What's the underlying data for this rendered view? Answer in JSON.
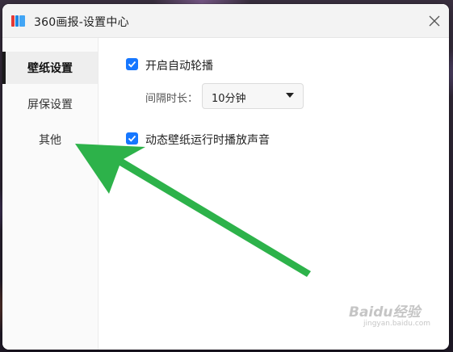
{
  "window": {
    "title": "360画报-设置中心"
  },
  "sidebar": {
    "items": [
      {
        "label": "壁纸设置",
        "active": true
      },
      {
        "label": "屏保设置",
        "active": false
      },
      {
        "label": "其他",
        "active": false
      }
    ]
  },
  "wallpaper_settings": {
    "auto_rotate": {
      "label": "开启自动轮播",
      "checked": true
    },
    "interval": {
      "label": "间隔时长：",
      "selected": "10分钟"
    },
    "dynamic_sound": {
      "label": "动态壁纸运行时播放声音",
      "checked": true
    }
  },
  "watermark": {
    "brand": "Baidu经验",
    "site": "jingyan.baidu.com"
  },
  "colors": {
    "accent": "#1677ff",
    "arrow": "#2db24a"
  },
  "icons": {
    "close": "close-icon",
    "app": "app-logo-icon",
    "caret": "caret-down-icon",
    "check": "check-icon"
  }
}
